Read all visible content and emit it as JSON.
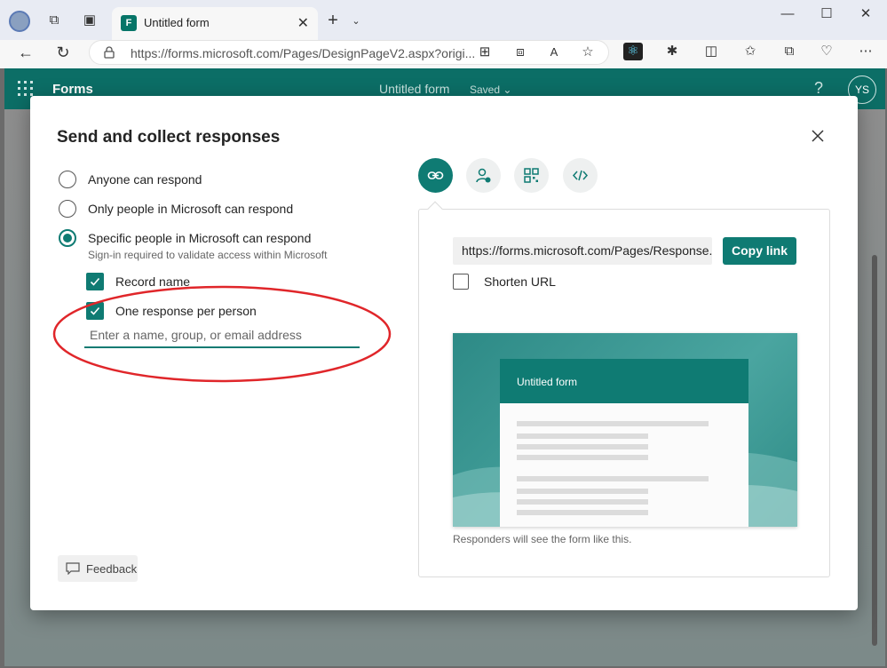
{
  "browser": {
    "tab_title": "Untitled form",
    "url": "https://forms.microsoft.com/Pages/DesignPageV2.aspx?origi...",
    "favicon_letter": "F"
  },
  "app": {
    "name": "Forms",
    "form_title": "Untitled form",
    "saved_status": "Saved",
    "user_initials": "YS",
    "help_label": "?"
  },
  "dialog": {
    "title": "Send and collect responses",
    "options": [
      {
        "label": "Anyone can respond",
        "checked": false
      },
      {
        "label": "Only people in Microsoft can respond",
        "checked": false
      },
      {
        "label": "Specific people in Microsoft can respond",
        "checked": true
      }
    ],
    "sub_label": "Sign-in required to validate access within Microsoft",
    "record_name": {
      "label": "Record name",
      "checked": true
    },
    "one_response": {
      "label": "One response per person",
      "checked": true
    },
    "people_input": {
      "placeholder": "Enter a name, group, or email address",
      "value": ""
    },
    "feedback_label": "Feedback"
  },
  "share": {
    "methods": [
      "link-icon",
      "invite-person-icon",
      "qr-code-icon",
      "embed-code-icon"
    ],
    "active_method": "link-icon",
    "link": "https://forms.microsoft.com/Pages/Response...",
    "copy_label": "Copy link",
    "shorten_label": "Shorten URL",
    "shorten_checked": false,
    "preview_title": "Untitled form",
    "preview_caption": "Responders will see the form like this."
  },
  "colors": {
    "accent": "#0f7b73",
    "header": "#0c6e66",
    "annotation": "#e0262a"
  }
}
